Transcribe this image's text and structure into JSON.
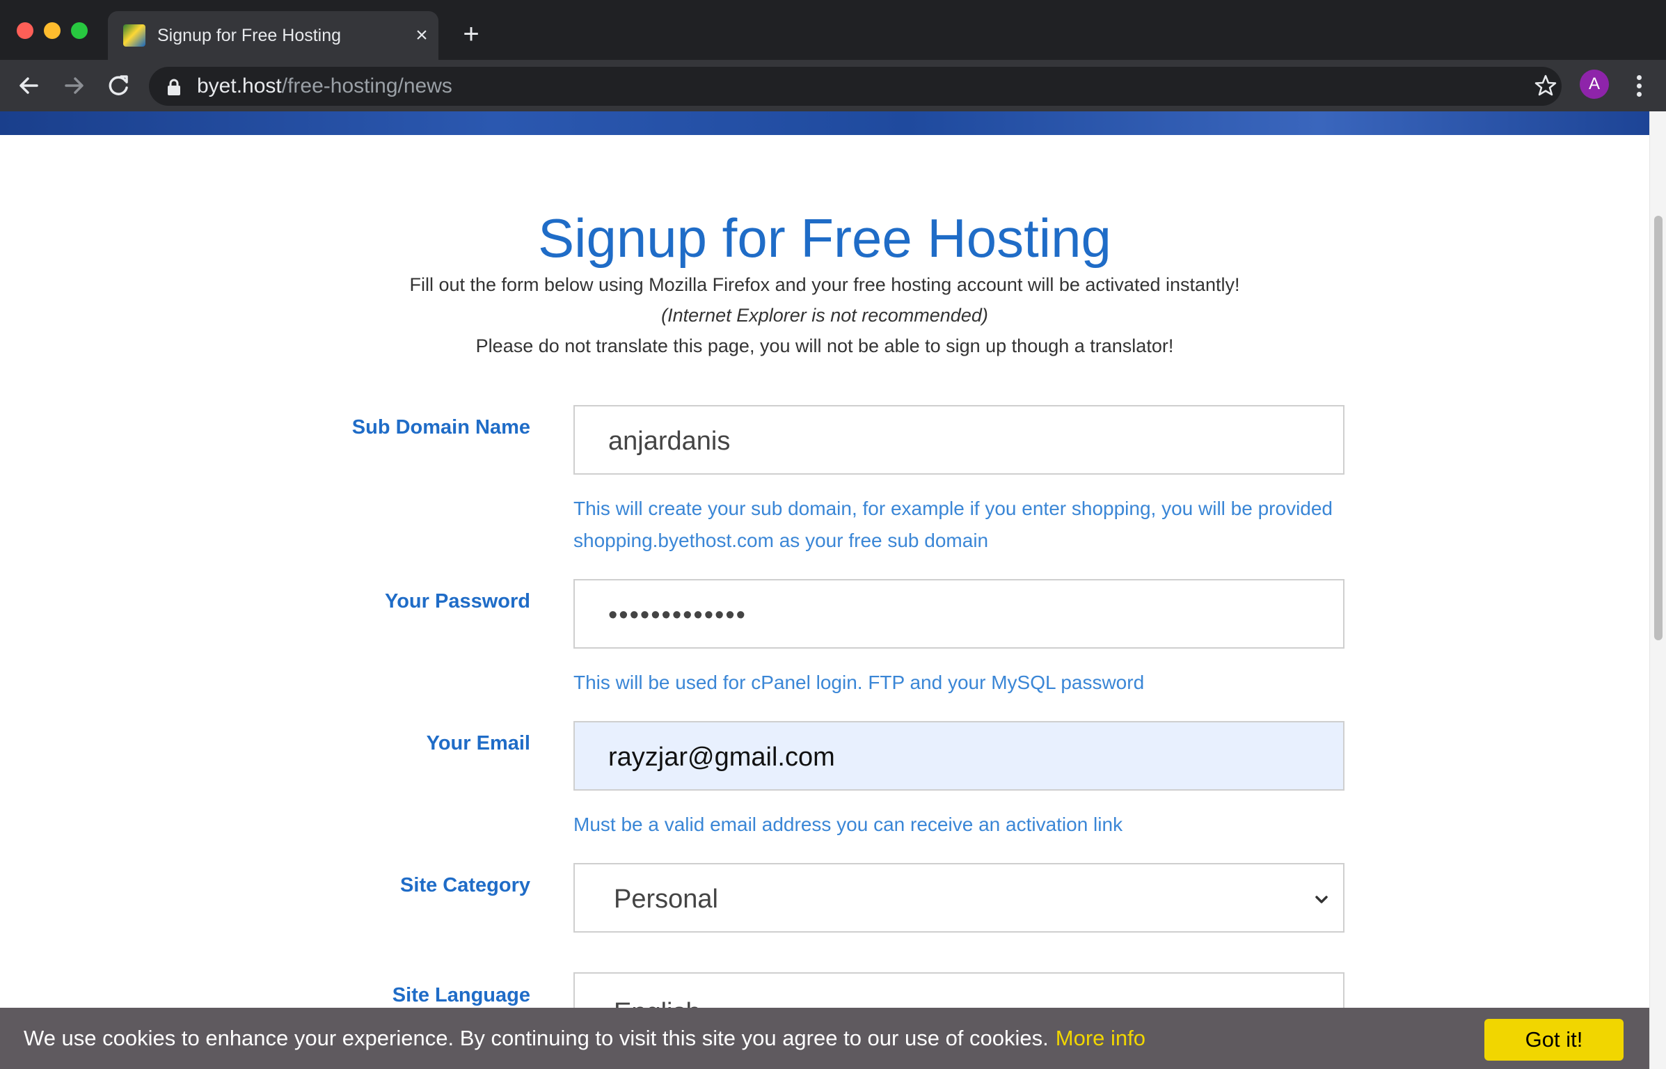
{
  "browser": {
    "tab_title": "Signup for Free Hosting",
    "tab_close": "×",
    "new_tab": "+",
    "url_host": "byet.host",
    "url_path": "/free-hosting/news",
    "profile_initial": "A",
    "icons": [
      "close-window",
      "minimize",
      "zoom",
      "favicon",
      "back-arrow",
      "forward-arrow",
      "reload",
      "lock",
      "star",
      "kebab-menu"
    ],
    "colors": {
      "frame": "#202124",
      "toolbar": "#35363a",
      "avatar": "#8e24aa"
    }
  },
  "page": {
    "title": "Signup for Free Hosting",
    "intro": [
      "Fill out the form below using Mozilla Firefox and your free hosting account will be activated instantly!",
      "(Internet Explorer is not recommended)",
      "Please do not translate this page, you will not be able to sign up though a translator!"
    ],
    "colors": {
      "accent": "#1f6cc7",
      "hint": "#3a86d6",
      "autofill_bg": "#e8f0fe"
    }
  },
  "form": {
    "subdomain": {
      "label": "Sub Domain Name",
      "value": "anjardanis",
      "hint": "This will create your sub domain, for example if you enter shopping, you will be provided shopping.byethost.com as your free sub domain"
    },
    "password": {
      "label": "Your Password",
      "value": "•••••••••••••",
      "hint": "This will be used for cPanel login. FTP and your MySQL password"
    },
    "email": {
      "label": "Your Email",
      "value": "rayzjar@gmail.com",
      "hint": "Must be a valid email address you can receive an activation link"
    },
    "category": {
      "label": "Site Category",
      "selected": "Personal"
    },
    "language": {
      "label": "Site Language",
      "selected": "English"
    }
  },
  "cookie_bar": {
    "message": "We use cookies to enhance your experience. By continuing to visit this site you agree to our use of cookies.",
    "link": "More info",
    "button": "Got it!",
    "colors": {
      "bar": "#5f5a5f",
      "accent": "#f1d600"
    }
  }
}
